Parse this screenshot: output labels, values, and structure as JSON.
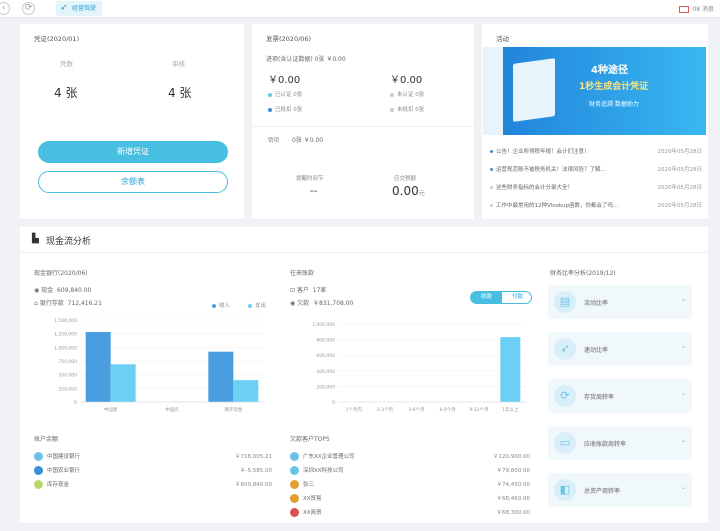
{
  "topbar": {
    "back_icon": "back-arrow-icon",
    "refresh_icon": "refresh-icon",
    "active_tab": "经营驾驶",
    "right_text": "08 消息"
  },
  "voucher": {
    "title": "凭证(2020/01)",
    "left_label": "凭数",
    "left_value": "4 张",
    "right_label": "审核",
    "right_value": "4 张",
    "new_button": "新增凭证",
    "ledger_button": "余额表"
  },
  "invoice": {
    "title": "发票(2020/06)",
    "sub_line": "进项(含认证数据) 0张 ￥0.00",
    "left_amount": "￥0.00",
    "right_amount": "￥0.00",
    "items_left": [
      "已认证  0张",
      "已抵扣  0张"
    ],
    "items_right": [
      "未认证  0张",
      "未抵扣  0张"
    ],
    "sales_line_label": "销项",
    "sales_line_value": "0张     ￥0.00",
    "bottom_left_label": "提醒时间节",
    "bottom_left_value": "--",
    "bottom_right_label": "应交税额",
    "bottom_right_value": "0.00",
    "bottom_right_unit": "元"
  },
  "activity": {
    "title": "活动",
    "banner_line1": "4种途径",
    "banner_line2": "1秒生成会计凭证",
    "banner_line3": "财务追溯 数据助力",
    "news": [
      {
        "text": "公告！企业所得税年报！会计们注意！",
        "date": "2020年05月28日"
      },
      {
        "text": "运营规范账不被税务机关！法律风险？了解...",
        "date": "2020年05月28日"
      },
      {
        "text": "这些财务指标的会计分录大全！",
        "date": "2020年05月28日"
      },
      {
        "text": "工作中最常用的12种Vlookup函数，你都会了吗...",
        "date": "2020年05月28日"
      }
    ]
  },
  "cashflow": {
    "section_title": "现金流分析",
    "bank": {
      "title": "现金银行(2020/06)",
      "cash_label": "现金",
      "cash_value": "609,840.00",
      "bank_label": "银行存款",
      "bank_value": "712,416.21",
      "legend_in": "收入",
      "legend_out": "支出",
      "accounts_title": "账户余额",
      "accounts": [
        {
          "name": "中国建设银行",
          "value": "￥718,005.21",
          "color": "#6cc3e6"
        },
        {
          "name": "中国农业银行",
          "value": "￥-5,585.00",
          "color": "#3a8fd8"
        },
        {
          "name": "库存现金",
          "value": "￥609,840.00",
          "color": "#b8d86b"
        }
      ]
    },
    "receivable": {
      "title": "往来账款",
      "customers_label": "客户",
      "customers_value": "17家",
      "amount_label": "欠款",
      "amount_value": "￥831,708.00",
      "toggle_on": "收款",
      "toggle_off": "付款",
      "top_title": "欠款客户TOP5",
      "top_customers": [
        {
          "name": "广东XX企业管理公司",
          "value": "￥120,900.00",
          "color": "#6cc3e6"
        },
        {
          "name": "深圳XX科技公司",
          "value": "￥79,800.00",
          "color": "#6cc3e6"
        },
        {
          "name": "张三",
          "value": "￥74,450.00",
          "color": "#e0a030"
        },
        {
          "name": "XX贸易",
          "value": "￥68,460.00",
          "color": "#e0a030"
        },
        {
          "name": "XX商贸",
          "value": "￥68,300.00",
          "color": "#d85050"
        }
      ]
    },
    "ratios": {
      "title": "财务比率分析(2019/12)",
      "items": [
        {
          "label": "流动比率",
          "icon": "chart-icon"
        },
        {
          "label": "速动比率",
          "icon": "rocket-icon"
        },
        {
          "label": "存货周转率",
          "icon": "refresh-icon"
        },
        {
          "label": "应收账款周转率",
          "icon": "receipt-icon"
        },
        {
          "label": "总资产周转率",
          "icon": "assets-icon"
        }
      ]
    }
  },
  "chart_data": [
    {
      "type": "bar",
      "categories": [
        "中国建",
        "中国农",
        "库存现金"
      ],
      "series": [
        {
          "name": "收入",
          "values": [
            1280000,
            0,
            920000
          ]
        },
        {
          "name": "支出",
          "values": [
            690000,
            5000,
            400000
          ]
        }
      ],
      "ylim": [
        0,
        1500000
      ],
      "yticks": [
        "1,500,000",
        "1,250,000",
        "1,000,000",
        "750,000",
        "500,000",
        "250,000",
        "0"
      ],
      "colors": [
        "#4a9ee0",
        "#6cd0f4"
      ]
    },
    {
      "type": "bar",
      "categories": [
        "1个月内",
        "1-3个月",
        "3-6个月",
        "6-9个月",
        "9-12个月",
        "1年以上"
      ],
      "series": [
        {
          "values": [
            0,
            0,
            0,
            0,
            0,
            831708
          ]
        }
      ],
      "ylim": [
        0,
        1000000
      ],
      "yticks": [
        "1,000,000",
        "800,000",
        "600,000",
        "400,000",
        "200,000",
        "0"
      ],
      "colors": [
        "#6cd0f4"
      ]
    }
  ]
}
